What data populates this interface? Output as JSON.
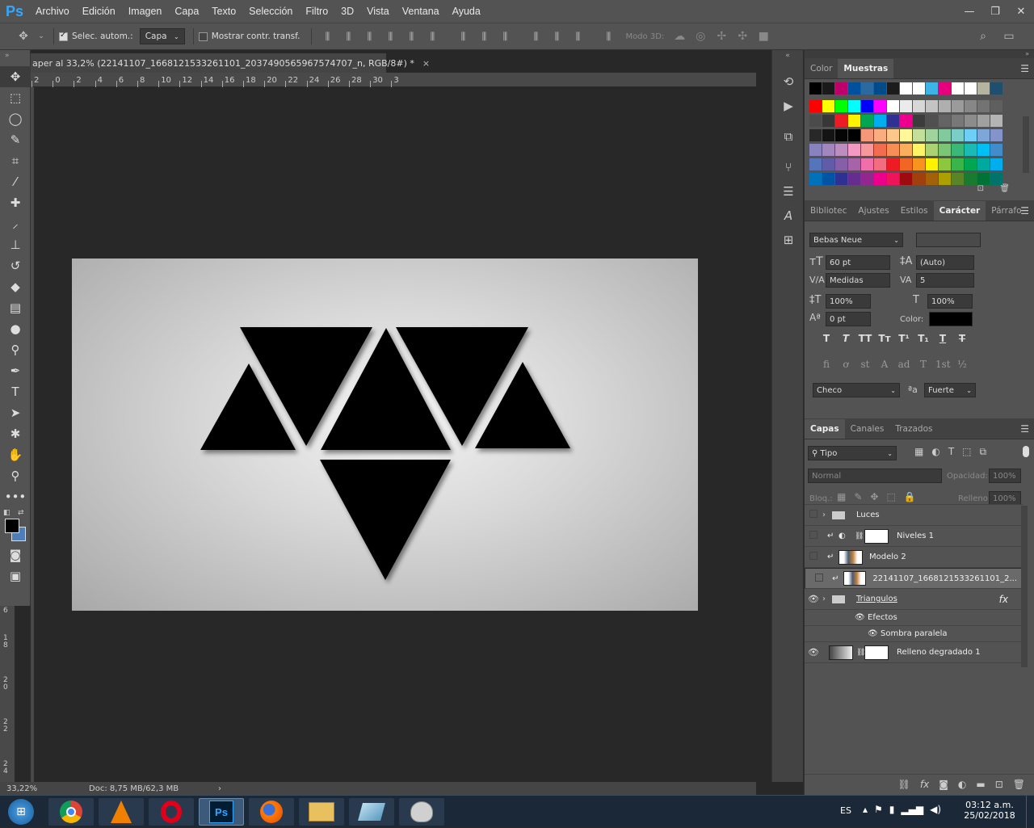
{
  "menu": [
    "Archivo",
    "Edición",
    "Imagen",
    "Capa",
    "Texto",
    "Selección",
    "Filtro",
    "3D",
    "Vista",
    "Ventana",
    "Ayuda"
  ],
  "logo": "Ps",
  "window_controls": [
    "—",
    "❐",
    "✕"
  ],
  "options": {
    "auto_select_label": "Selec. autom.:",
    "auto_select_target": "Capa",
    "transform_label": "Mostrar contr. transf.",
    "mode3d_label": "Modo 3D:"
  },
  "doc_tab": "aper al 33,2% (22141107_1668121533261101_2037490565967574707_n, RGB/8#) *",
  "doc_tab_close": "×",
  "ruler_h": [
    "2",
    "0",
    "2",
    "4",
    "6",
    "8",
    "10",
    "12",
    "14",
    "16",
    "18",
    "20",
    "22",
    "24",
    "26",
    "28",
    "30",
    "3"
  ],
  "ruler_v": [
    "6",
    "1\n8",
    "2\n0",
    "2\n2",
    "2\n4"
  ],
  "status": {
    "zoom": "33,22%",
    "doc": "Doc: 8,75 MB/62,3 MB",
    "arrow": "›"
  },
  "swatches_panel": {
    "tabs": [
      "Color",
      "Muestras"
    ],
    "active": "Muestras"
  },
  "swatch_colors": {
    "row0": [
      "#000000",
      "#1a1a1a",
      "#c0006a",
      "#0050a0",
      "#2a6aa0",
      "#004c8a",
      "#1c1c1c",
      "#ffffff",
      "#ffffff",
      "#3cb4e6",
      "#e6007e",
      "#ffffff",
      "#ffffff",
      "#b4b4a0",
      "#1e4f6e"
    ],
    "rows": [
      [
        "#ff0000",
        "#ffff00",
        "#00ff00",
        "#00ffff",
        "#0000ff",
        "#ff00ff",
        "#ffffff",
        "#ebebeb",
        "#d7d7d7",
        "#c3c3c3",
        "#afafaf",
        "#9b9b9b",
        "#878787",
        "#737373",
        "#5f5f5f"
      ],
      [
        "#4b4b4b",
        "#373737",
        "#ed1c24",
        "#fff200",
        "#00a651",
        "#00aeef",
        "#2e3192",
        "#ec008c",
        "#3c3c3c",
        "#505050",
        "#646464",
        "#787878",
        "#8c8c8c",
        "#a0a0a0",
        "#b4b4b4"
      ],
      [
        "#282828",
        "#141414",
        "#050505",
        "#000000",
        "#f7977a",
        "#f9ad81",
        "#fdc68a",
        "#fff79a",
        "#c4df9b",
        "#a3d39c",
        "#82ca9d",
        "#7bcdc8",
        "#6ecff6",
        "#7ea7d8",
        "#8493ca"
      ],
      [
        "#8882be",
        "#a187be",
        "#bc8dbf",
        "#f49ac2",
        "#f6989d",
        "#f26c4f",
        "#f68e55",
        "#fbaf5c",
        "#fff467",
        "#acd372",
        "#7cc576",
        "#3bb878",
        "#1abbb4",
        "#00bff3",
        "#438ccb"
      ],
      [
        "#5574b9",
        "#605ca8",
        "#855fa8",
        "#a763a8",
        "#f06ea9",
        "#f26d7d",
        "#ed1c24",
        "#f26522",
        "#f7941d",
        "#fff200",
        "#8dc73f",
        "#39b54a",
        "#00a651",
        "#00a99d",
        "#00aeef"
      ],
      [
        "#0072bc",
        "#0054a6",
        "#2e3192",
        "#662d91",
        "#92278f",
        "#ec008c",
        "#ed145b",
        "#9e0b0f",
        "#a0410d",
        "#a36209",
        "#aba000",
        "#598527",
        "#197b30",
        "#007236",
        "#00746b"
      ]
    ]
  },
  "char_panel": {
    "tabs": [
      "Bibliotec",
      "Ajustes",
      "Estilos",
      "Carácter",
      "Párrafo"
    ],
    "active": "Carácter",
    "font": "Bebas Neue",
    "size": "60 pt",
    "leading": "(Auto)",
    "kerning": "Medidas",
    "tracking": "5",
    "vscale": "100%",
    "hscale": "100%",
    "baseline": "0 pt",
    "color_label": "Color:",
    "color": "#000000",
    "type_buttons": [
      "T",
      "T",
      "TT",
      "Tт",
      "T¹",
      "T₁",
      "T",
      "T"
    ],
    "ot_buttons": [
      "fi",
      "ơ",
      "st",
      "A",
      "ad",
      "T",
      "1st",
      "½"
    ],
    "language": "Checo",
    "aa_label": "ªa",
    "antialias": "Fuerte"
  },
  "layers_panel": {
    "tabs": [
      "Capas",
      "Canales",
      "Trazados"
    ],
    "active": "Capas",
    "filter": "Tipo",
    "blend": "Normal",
    "opacity_label": "Opacidad:",
    "opacity": "100%",
    "lock_label": "Bloq.:",
    "fill_label": "Relleno:",
    "fill": "100%",
    "layers": [
      {
        "name": "Luces",
        "kind": "group",
        "visible": false
      },
      {
        "name": "Niveles 1",
        "kind": "adjust",
        "visible": false
      },
      {
        "name": "Modelo 2",
        "kind": "image",
        "visible": false
      },
      {
        "name": "22141107_1668121533261101_2...",
        "kind": "image",
        "visible": false,
        "selected": true
      },
      {
        "name": "Triangulos",
        "kind": "group",
        "visible": true,
        "fx": "fx"
      },
      {
        "name": "Efectos",
        "kind": "effect",
        "visible": true
      },
      {
        "name": "Sombra paralela",
        "kind": "effect2",
        "visible": true
      },
      {
        "name": "Relleno degradado 1",
        "kind": "fill",
        "visible": true
      }
    ]
  },
  "taskbar": {
    "lang": "ES",
    "time": "03:12 a.m.",
    "date": "25/02/2018"
  }
}
